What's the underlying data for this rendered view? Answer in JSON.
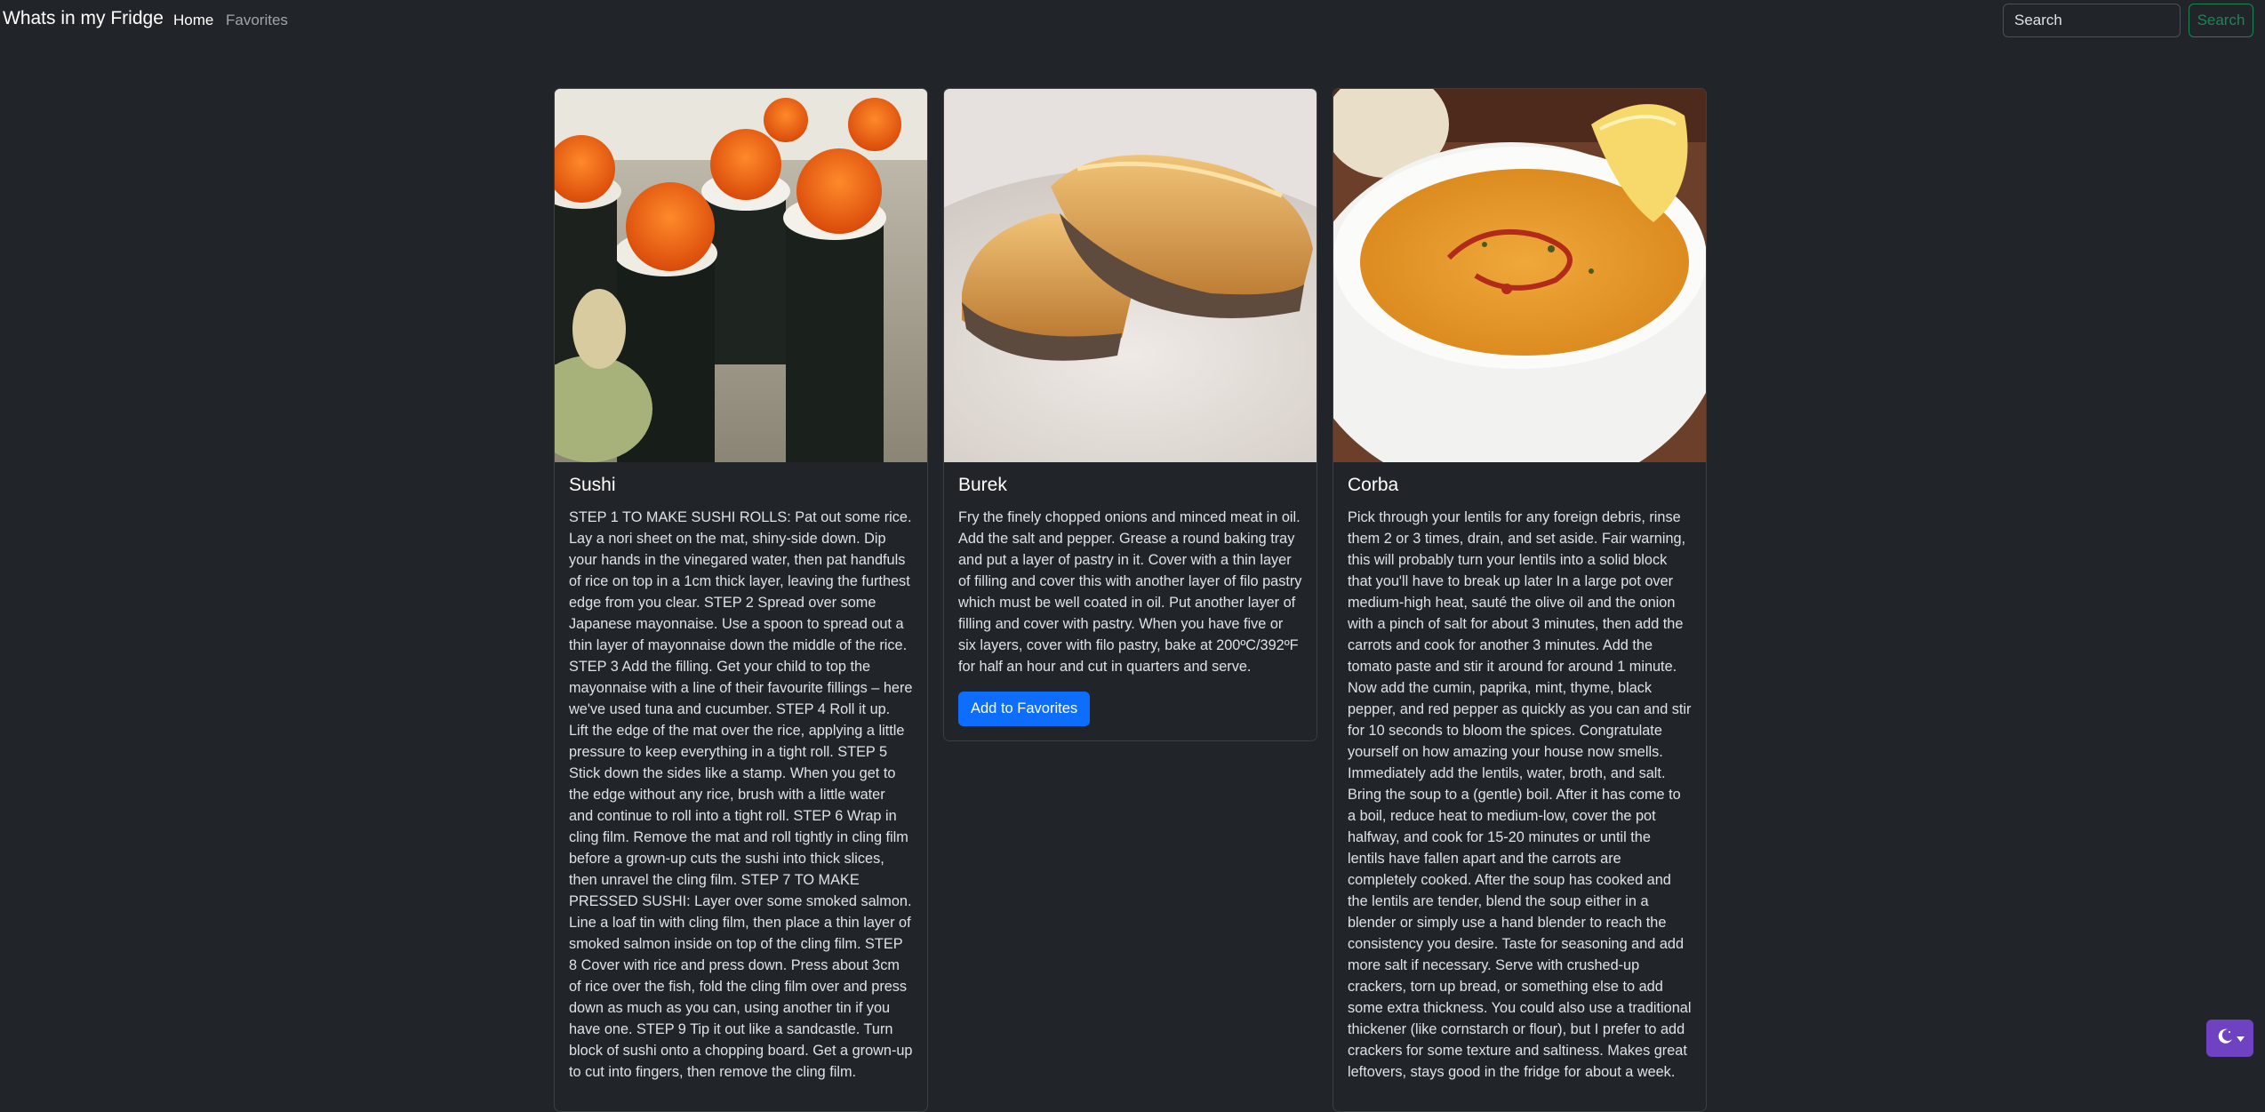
{
  "navbar": {
    "brand": "Whats in my Fridge",
    "links": [
      "Home",
      "Favorites"
    ],
    "search_placeholder": "Search",
    "search_button": "Search"
  },
  "cards": [
    {
      "title": "Sushi",
      "text": "STEP 1 TO MAKE SUSHI ROLLS: Pat out some rice. Lay a nori sheet on the mat, shiny-side down. Dip your hands in the vinegared water, then pat handfuls of rice on top in a 1cm thick layer, leaving the furthest edge from you clear. STEP 2 Spread over some Japanese mayonnaise. Use a spoon to spread out a thin layer of mayonnaise down the middle of the rice. STEP 3 Add the filling. Get your child to top the mayonnaise with a line of their favourite fillings – here we've used tuna and cucumber. STEP 4 Roll it up. Lift the edge of the mat over the rice, applying a little pressure to keep everything in a tight roll. STEP 5 Stick down the sides like a stamp. When you get to the edge without any rice, brush with a little water and continue to roll into a tight roll. STEP 6 Wrap in cling film. Remove the mat and roll tightly in cling film before a grown-up cuts the sushi into thick slices, then unravel the cling film. STEP 7 TO MAKE PRESSED SUSHI: Layer over some smoked salmon. Line a loaf tin with cling film, then place a thin layer of smoked salmon inside on top of the cling film. STEP 8 Cover with rice and press down. Press about 3cm of rice over the fish, fold the cling film over and press down as much as you can, using another tin if you have one. STEP 9 Tip it out like a sandcastle. Turn block of sushi onto a chopping board. Get a grown-up to cut into fingers, then remove the cling film."
    },
    {
      "title": "Burek",
      "text": "Fry the finely chopped onions and minced meat in oil. Add the salt and pepper. Grease a round baking tray and put a layer of pastry in it. Cover with a thin layer of filling and cover this with another layer of filo pastry which must be well coated in oil. Put another layer of filling and cover with pastry. When you have five or six layers, cover with filo pastry, bake at 200ºC/392ºF for half an hour and cut in quarters and serve.",
      "button": "Add to Favorites"
    },
    {
      "title": "Corba",
      "text": "Pick through your lentils for any foreign debris, rinse them 2 or 3 times, drain, and set aside. Fair warning, this will probably turn your lentils into a solid block that you'll have to break up later In a large pot over medium-high heat, sauté the olive oil and the onion with a pinch of salt for about 3 minutes, then add the carrots and cook for another 3 minutes. Add the tomato paste and stir it around for around 1 minute. Now add the cumin, paprika, mint, thyme, black pepper, and red pepper as quickly as you can and stir for 10 seconds to bloom the spices. Congratulate yourself on how amazing your house now smells. Immediately add the lentils, water, broth, and salt. Bring the soup to a (gentle) boil. After it has come to a boil, reduce heat to medium-low, cover the pot halfway, and cook for 15-20 minutes or until the lentils have fallen apart and the carrots are completely cooked. After the soup has cooked and the lentils are tender, blend the soup either in a blender or simply use a hand blender to reach the consistency you desire. Taste for seasoning and add more salt if necessary. Serve with crushed-up crackers, torn up bread, or something else to add some extra thickness. You could also use a traditional thickener (like cornstarch or flour), but I prefer to add crackers for some texture and saltiness. Makes great leftovers, stays good in the fridge for about a week."
    }
  ],
  "theme_toggle_icons": [
    "moon-icon",
    "caret-down-icon"
  ],
  "colors": {
    "background": "#212529",
    "primary": "#0d6efd",
    "success": "#198754",
    "theme_toggle": "#6f42c1"
  }
}
